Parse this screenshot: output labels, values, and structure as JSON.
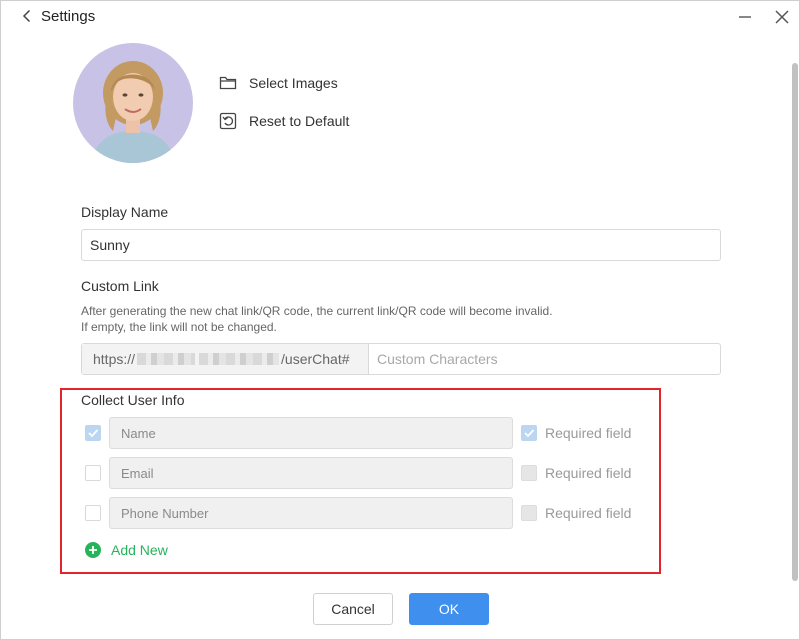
{
  "window": {
    "title": "Settings"
  },
  "avatar_actions": {
    "select_images": "Select Images",
    "reset_default": "Reset to Default"
  },
  "display_name": {
    "label": "Display Name",
    "value": "Sunny"
  },
  "custom_link": {
    "label": "Custom Link",
    "hint_line1": "After generating the new chat link/QR code, the current link/QR code will become invalid.",
    "hint_line2": "If empty, the link will not be changed.",
    "prefix_start": "https://",
    "prefix_end": "/userChat#",
    "placeholder": "Custom Characters"
  },
  "collect_info": {
    "label": "Collect User Info",
    "fields": [
      {
        "placeholder": "Name",
        "checked": true,
        "required_checked": true,
        "required_label": "Required field"
      },
      {
        "placeholder": "Email",
        "checked": false,
        "required_checked": false,
        "required_label": "Required field"
      },
      {
        "placeholder": "Phone Number",
        "checked": false,
        "required_checked": false,
        "required_label": "Required field"
      }
    ],
    "add_new": "Add New"
  },
  "buttons": {
    "cancel": "Cancel",
    "ok": "OK"
  },
  "colors": {
    "accent": "#3e8fee",
    "add_new": "#27b35a",
    "highlight_border": "#e0262c",
    "checkbox_checked": "#bcd6f2"
  },
  "icons": {
    "back": "chevron-left-icon",
    "minimize": "minimize-icon",
    "close": "close-icon",
    "select_images": "folder-icon",
    "reset_default": "reset-icon",
    "add_new": "plus-circle-icon",
    "checkbox_check": "check-icon"
  }
}
